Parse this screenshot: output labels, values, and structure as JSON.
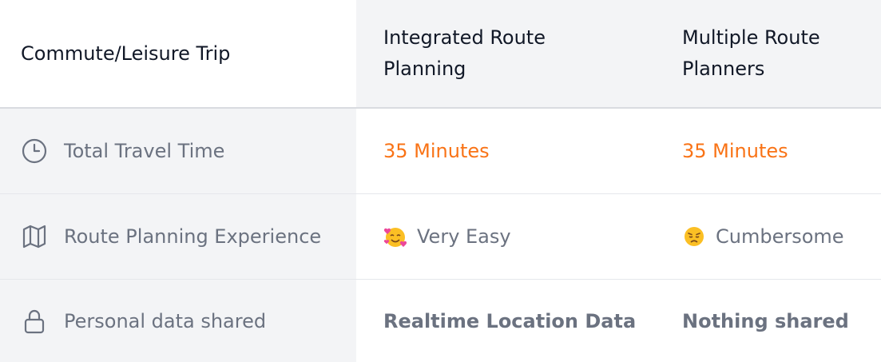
{
  "header": {
    "title": "Commute/Leisure Trip",
    "col1": "Integrated Route\nPlanning",
    "col2": "Multiple Route\nPlanners"
  },
  "rows": [
    {
      "label": "Total Travel Time",
      "icon": "clock-icon",
      "col1": "35 Minutes",
      "col2": "35 Minutes"
    },
    {
      "label": "Route Planning Experience",
      "icon": "map-icon",
      "col1": "Very Easy",
      "col1_emoji": "smiling-face-with-hearts",
      "col2": "Cumbersome",
      "col2_emoji": "worried-face"
    },
    {
      "label": "Personal data shared",
      "icon": "lock-icon",
      "col1": "Realtime Location Data",
      "col2": "Nothing shared"
    }
  ],
  "colors": {
    "accent_orange": "#f97316",
    "muted_text": "#6b7280",
    "header_bg": "#f3f4f6"
  }
}
